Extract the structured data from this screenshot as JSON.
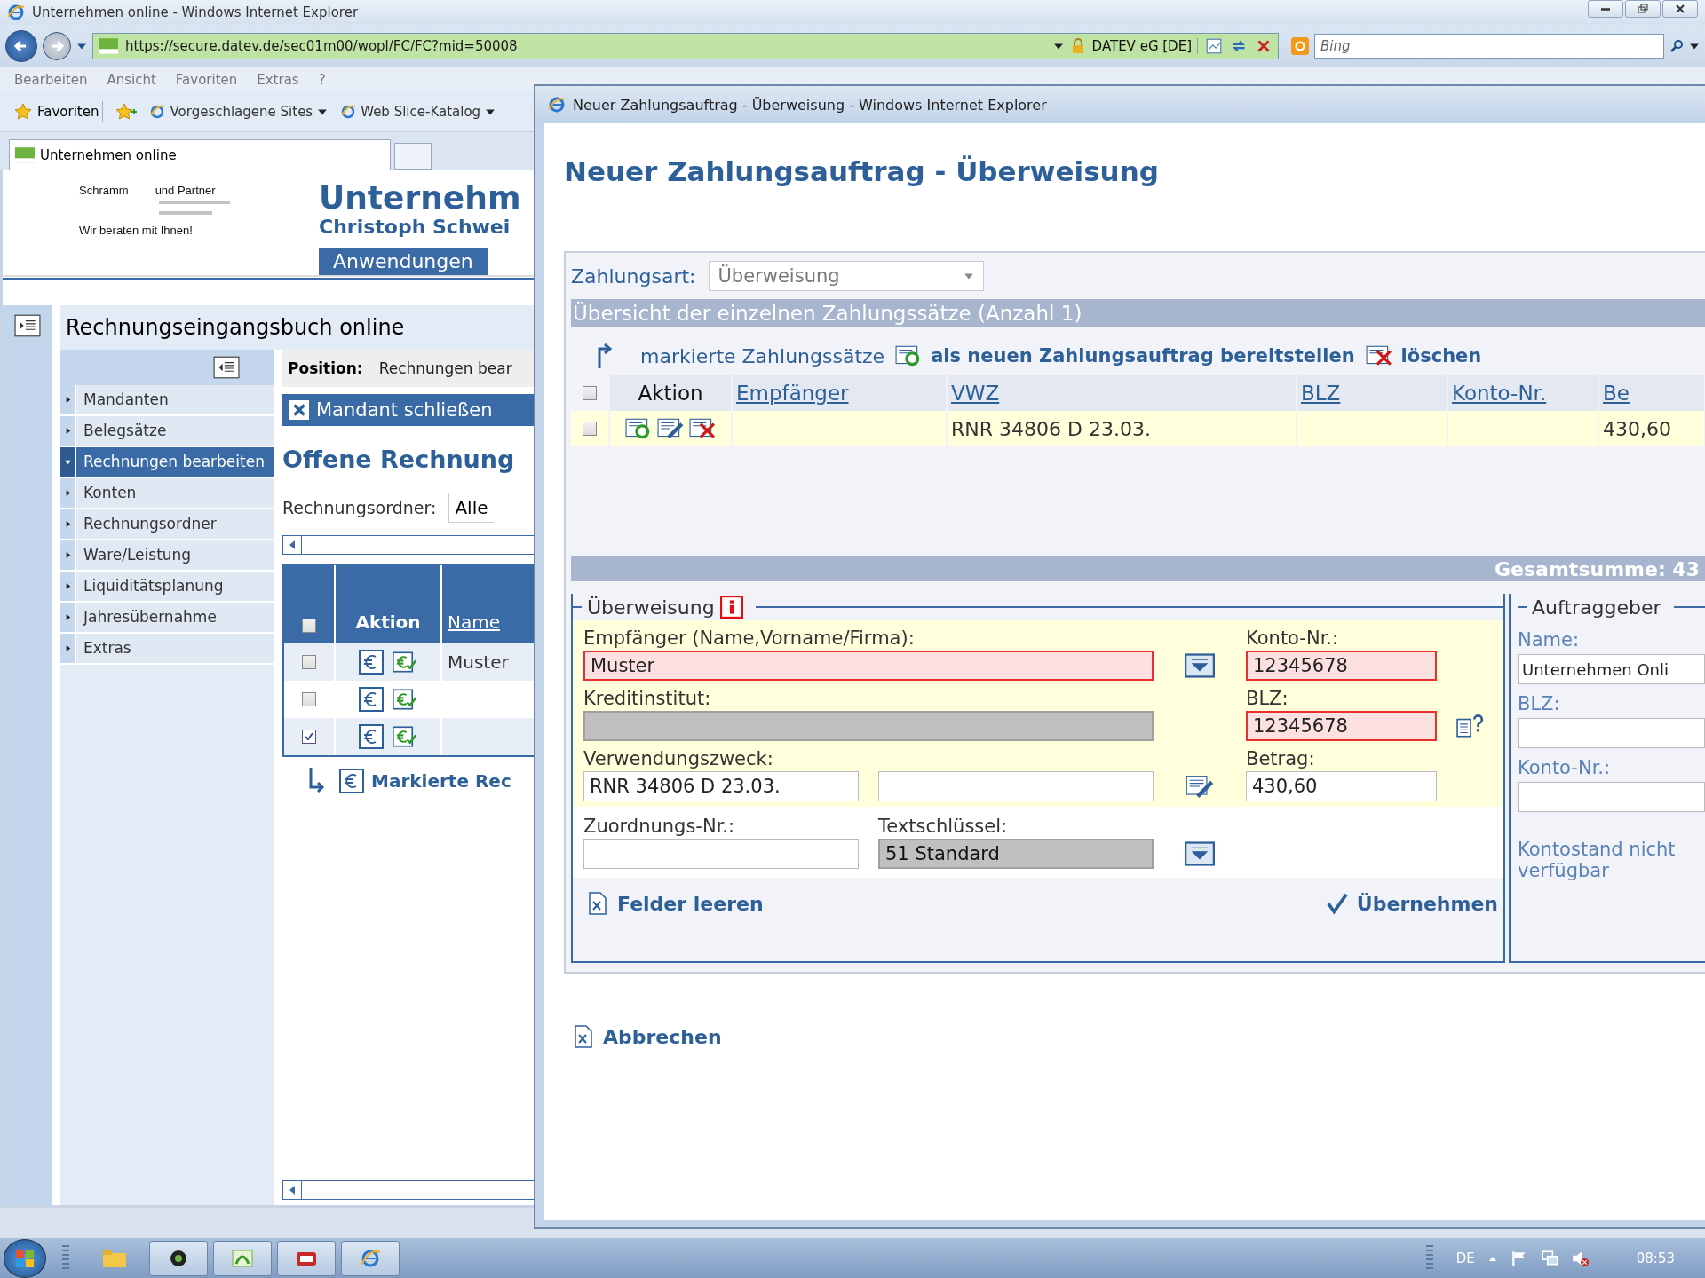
{
  "browser": {
    "title": "Unternehmen online - Windows Internet Explorer",
    "url": "https://secure.datev.de/sec01m00/wopl/FC/FC?mid=50008",
    "certificate": "DATEV eG [DE]",
    "search_placeholder": "Bing",
    "menu": [
      "Bearbeiten",
      "Ansicht",
      "Favoriten",
      "Extras",
      "?"
    ],
    "favorites_button": "Favoriten",
    "favorites": [
      "Vorgeschlagene Sites",
      "Web Slice-Katalog"
    ],
    "tabs": [
      {
        "label": "Unternehmen online",
        "selected": true
      }
    ]
  },
  "page": {
    "logo": {
      "name": "Schramm",
      "partner": "und Partner",
      "tagline": "Wir beraten mit Ihnen!"
    },
    "heading": "Unternehm",
    "subheading": "Christoph Schwei",
    "nav_tab": "Anwendungen",
    "app_title": "Rechnungseingangsbuch online",
    "menu": [
      {
        "label": "Mandanten",
        "selected": false
      },
      {
        "label": "Belegsätze",
        "selected": false
      },
      {
        "label": "Rechnungen bearbeiten",
        "selected": true
      },
      {
        "label": "Konten",
        "selected": false
      },
      {
        "label": "Rechnungsordner",
        "selected": false
      },
      {
        "label": "Ware/Leistung",
        "selected": false
      },
      {
        "label": "Liquiditätsplanung",
        "selected": false
      },
      {
        "label": "Jahresübernahme",
        "selected": false
      },
      {
        "label": "Extras",
        "selected": false
      }
    ],
    "position_label": "Position:",
    "position_link": "Rechnungen bear",
    "close_button": "Mandant schließen",
    "section_title": "Offene Rechnung",
    "folder_label": "Rechnungsordner:",
    "folder_value": "Alle",
    "table": {
      "columns": [
        "Aktion",
        "Name"
      ],
      "header_checked": false,
      "rows": [
        {
          "checked": false,
          "name": "Muster"
        },
        {
          "checked": false
        },
        {
          "checked": true
        }
      ]
    },
    "marked_action": "Markierte Rec"
  },
  "dialog": {
    "title": "Neuer Zahlungsauftrag - Überweisung - Windows Internet Explorer",
    "heading": "Neuer Zahlungsauftrag - Überweisung",
    "payment_type_label": "Zahlungsart:",
    "payment_type": "Überweisung",
    "overview_title": "Übersicht der einzelnen Zahlungssätze (Anzahl 1)",
    "actions": [
      "markierte Zahlungssätze",
      "als neuen Zahlungsauftrag bereitstellen",
      "löschen"
    ],
    "table": {
      "header_checked": false,
      "columns": [
        {
          "label": "Aktion",
          "link": false
        },
        {
          "label": "Empfänger",
          "link": true
        },
        {
          "label": "VWZ",
          "link": true
        },
        {
          "label": "BLZ",
          "link": true
        },
        {
          "label": "Konto-Nr.",
          "link": true
        },
        {
          "label": "Be",
          "link": true
        }
      ],
      "rows": [
        {
          "checked": false,
          "cells": [
            "",
            "",
            "RNR 34806 D 23.03.",
            "",
            "",
            "430,60"
          ]
        }
      ]
    },
    "total": "Gesamtsumme: 43",
    "form": {
      "legend": "Überweisung",
      "recipient": {
        "label": "Empfänger (Name,Vorname/Firma):",
        "value": "Muster",
        "invalid": true
      },
      "account": {
        "label": "Konto-Nr.:",
        "value": "12345678",
        "invalid": true
      },
      "bank": {
        "label": "Kreditinstitut:",
        "disabled": true
      },
      "blz": {
        "label": "BLZ:",
        "value": "12345678",
        "invalid": true
      },
      "purpose": {
        "label": "Verwendungszweck:",
        "value": "RNR 34806 D 23.03."
      },
      "amount": {
        "label": "Betrag:",
        "value": "430,60"
      },
      "assignment": {
        "label": "Zuordnungs-Nr.:"
      },
      "text_key": {
        "label": "Textschlüssel:",
        "value": "51 Standard",
        "disabled": true
      },
      "clear_button": "Felder leeren",
      "apply_button": "Übernehmen"
    },
    "payer": {
      "legend": "Auftraggeber",
      "name_label": "Name:",
      "name": "Unternehmen Onli",
      "blz_label": "BLZ:",
      "account_label": "Konto-Nr.:",
      "balance": "Kontostand nicht verfügbar"
    },
    "cancel_button": "Abbrechen"
  },
  "taskbar": {
    "language": "DE",
    "time": "08:53"
  }
}
